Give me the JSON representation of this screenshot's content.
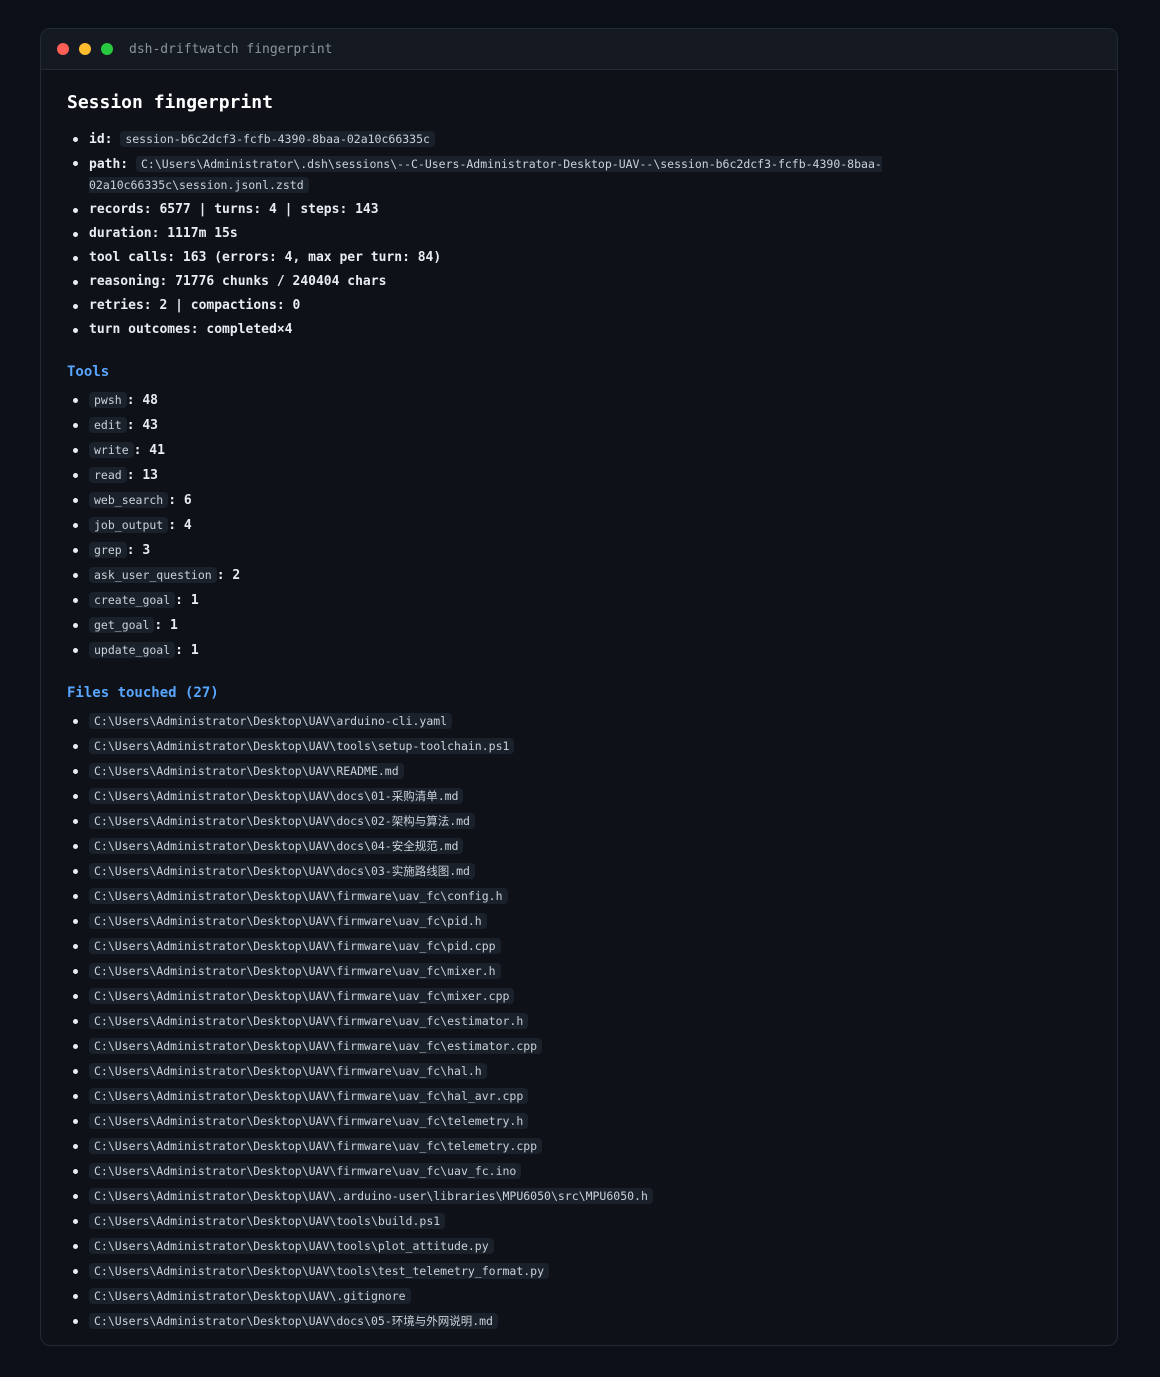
{
  "window": {
    "title": "dsh-driftwatch fingerprint"
  },
  "session": {
    "title": "Session fingerprint",
    "id_label": "id:",
    "id": "session-b6c2dcf3-fcfb-4390-8baa-02a10c66335c",
    "path_label": "path:",
    "path": "C:\\Users\\Administrator\\.dsh\\sessions\\--C-Users-Administrator-Desktop-UAV--\\session-b6c2dcf3-fcfb-4390-8baa-02a10c66335c\\session.jsonl.zstd",
    "stats": [
      "records: 6577 | turns: 4 | steps: 143",
      "duration: 1117m 15s",
      "tool calls: 163 (errors: 4, max per turn: 84)",
      "reasoning: 71776 chunks / 240404 chars",
      "retries: 2 | compactions: 0",
      "turn outcomes: completed×4"
    ]
  },
  "tools": {
    "heading": "Tools",
    "items": [
      {
        "name": "pwsh",
        "count": ": 48"
      },
      {
        "name": "edit",
        "count": ": 43"
      },
      {
        "name": "write",
        "count": ": 41"
      },
      {
        "name": "read",
        "count": ": 13"
      },
      {
        "name": "web_search",
        "count": ": 6"
      },
      {
        "name": "job_output",
        "count": ": 4"
      },
      {
        "name": "grep",
        "count": ": 3"
      },
      {
        "name": "ask_user_question",
        "count": ": 2"
      },
      {
        "name": "create_goal",
        "count": ": 1"
      },
      {
        "name": "get_goal",
        "count": ": 1"
      },
      {
        "name": "update_goal",
        "count": ": 1"
      }
    ]
  },
  "files": {
    "heading": "Files touched (27)",
    "items": [
      "C:\\Users\\Administrator\\Desktop\\UAV\\arduino-cli.yaml",
      "C:\\Users\\Administrator\\Desktop\\UAV\\tools\\setup-toolchain.ps1",
      "C:\\Users\\Administrator\\Desktop\\UAV\\README.md",
      "C:\\Users\\Administrator\\Desktop\\UAV\\docs\\01-采购清单.md",
      "C:\\Users\\Administrator\\Desktop\\UAV\\docs\\02-架构与算法.md",
      "C:\\Users\\Administrator\\Desktop\\UAV\\docs\\04-安全规范.md",
      "C:\\Users\\Administrator\\Desktop\\UAV\\docs\\03-实施路线图.md",
      "C:\\Users\\Administrator\\Desktop\\UAV\\firmware\\uav_fc\\config.h",
      "C:\\Users\\Administrator\\Desktop\\UAV\\firmware\\uav_fc\\pid.h",
      "C:\\Users\\Administrator\\Desktop\\UAV\\firmware\\uav_fc\\pid.cpp",
      "C:\\Users\\Administrator\\Desktop\\UAV\\firmware\\uav_fc\\mixer.h",
      "C:\\Users\\Administrator\\Desktop\\UAV\\firmware\\uav_fc\\mixer.cpp",
      "C:\\Users\\Administrator\\Desktop\\UAV\\firmware\\uav_fc\\estimator.h",
      "C:\\Users\\Administrator\\Desktop\\UAV\\firmware\\uav_fc\\estimator.cpp",
      "C:\\Users\\Administrator\\Desktop\\UAV\\firmware\\uav_fc\\hal.h",
      "C:\\Users\\Administrator\\Desktop\\UAV\\firmware\\uav_fc\\hal_avr.cpp",
      "C:\\Users\\Administrator\\Desktop\\UAV\\firmware\\uav_fc\\telemetry.h",
      "C:\\Users\\Administrator\\Desktop\\UAV\\firmware\\uav_fc\\telemetry.cpp",
      "C:\\Users\\Administrator\\Desktop\\UAV\\firmware\\uav_fc\\uav_fc.ino",
      "C:\\Users\\Administrator\\Desktop\\UAV\\.arduino-user\\libraries\\MPU6050\\src\\MPU6050.h",
      "C:\\Users\\Administrator\\Desktop\\UAV\\tools\\build.ps1",
      "C:\\Users\\Administrator\\Desktop\\UAV\\tools\\plot_attitude.py",
      "C:\\Users\\Administrator\\Desktop\\UAV\\tools\\test_telemetry_format.py",
      "C:\\Users\\Administrator\\Desktop\\UAV\\.gitignore",
      "C:\\Users\\Administrator\\Desktop\\UAV\\docs\\05-环境与外网说明.md"
    ]
  }
}
